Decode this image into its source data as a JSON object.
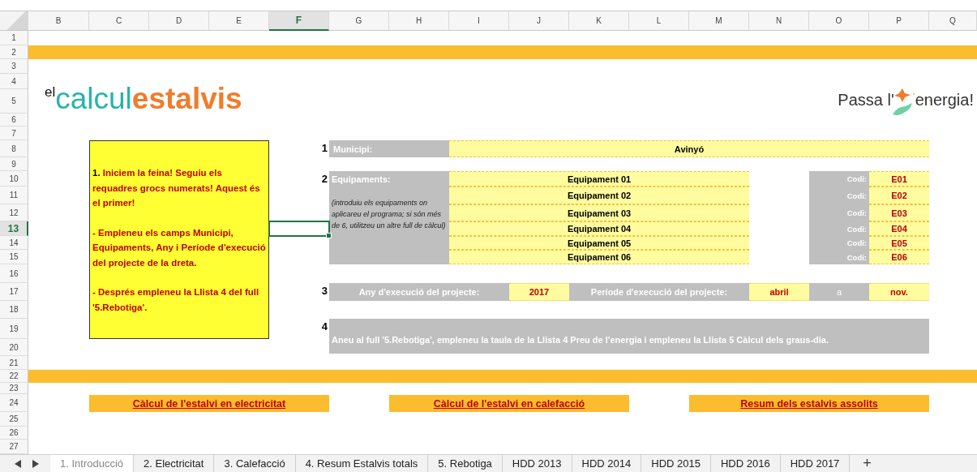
{
  "columns": [
    {
      "label": "B",
      "selected": false
    },
    {
      "label": "C",
      "selected": false
    },
    {
      "label": "D",
      "selected": false
    },
    {
      "label": "E",
      "selected": false
    },
    {
      "label": "F",
      "selected": true
    },
    {
      "label": "G",
      "selected": false
    },
    {
      "label": "H",
      "selected": false
    },
    {
      "label": "I",
      "selected": false
    },
    {
      "label": "J",
      "selected": false
    },
    {
      "label": "K",
      "selected": false
    },
    {
      "label": "L",
      "selected": false
    },
    {
      "label": "M",
      "selected": false
    },
    {
      "label": "N",
      "selected": false
    },
    {
      "label": "O",
      "selected": false
    },
    {
      "label": "P",
      "selected": false
    },
    {
      "label": "Q",
      "selected": false
    }
  ],
  "rows": [
    {
      "label": "1",
      "selected": false
    },
    {
      "label": "2",
      "selected": false
    },
    {
      "label": "3",
      "selected": false
    },
    {
      "label": "4",
      "selected": false
    },
    {
      "label": "5",
      "selected": false
    },
    {
      "label": "6",
      "selected": false
    },
    {
      "label": "7",
      "selected": false
    },
    {
      "label": "8",
      "selected": false
    },
    {
      "label": "9",
      "selected": false
    },
    {
      "label": "10",
      "selected": false
    },
    {
      "label": "11",
      "selected": false
    },
    {
      "label": "12",
      "selected": false
    },
    {
      "label": "13",
      "selected": true
    },
    {
      "label": "14",
      "selected": false
    },
    {
      "label": "15",
      "selected": false
    },
    {
      "label": "16",
      "selected": false
    },
    {
      "label": "17",
      "selected": false
    },
    {
      "label": "18",
      "selected": false
    },
    {
      "label": "19",
      "selected": false
    },
    {
      "label": "20",
      "selected": false
    },
    {
      "label": "21",
      "selected": false
    },
    {
      "label": "22",
      "selected": false
    },
    {
      "label": "23",
      "selected": false
    },
    {
      "label": "24",
      "selected": false
    },
    {
      "label": "25",
      "selected": false
    },
    {
      "label": "26",
      "selected": false
    },
    {
      "label": "27",
      "selected": false
    }
  ],
  "logo": {
    "prefix": "el",
    "part1": "calcul",
    "part2": "estalvis"
  },
  "slogan": {
    "before": "Passa l'",
    "after": "energia!"
  },
  "instructions": {
    "number": "1.",
    "paragraphs": [
      "Iniciem la feina! Seguiu els requadres grocs numerats! Aquest és el primer!",
      "- Empleneu els camps Municipi, Equipaments, Any i Període d'execució del projecte de la dreta.",
      "- Després empleneu la Llista 4 del full '5.Rebotiga'."
    ]
  },
  "municipality": {
    "number": "1",
    "label": "Municipi:",
    "value": "Avinyó"
  },
  "equipment": {
    "number": "2",
    "label": "Equipaments:",
    "note": "(introduiu els equipaments on aplicareu el programa; si són més de 6, utilitzeu un altre full de càlcul)",
    "items": [
      {
        "name": "Equipament 01",
        "code_label": "Codi:",
        "code": "E01"
      },
      {
        "name": "Equipament 02",
        "code_label": "Codi:",
        "code": "E02"
      },
      {
        "name": "Equipament 03",
        "code_label": "Codi:",
        "code": "E03"
      },
      {
        "name": "Equipament 04",
        "code_label": "Codi:",
        "code": "E04"
      },
      {
        "name": "Equipament 05",
        "code_label": "Codi:",
        "code": "E05"
      },
      {
        "name": "Equipament 06",
        "code_label": "Codi:",
        "code": "E06"
      }
    ]
  },
  "execution": {
    "number": "3",
    "year_label": "Any d'execució del projecte:",
    "year": "2017",
    "period_label": "Període d'execució del projecte:",
    "from": "abril",
    "to_label": "a",
    "to": "nov."
  },
  "step4": {
    "number": "4",
    "text": "Aneu al full '5.Rebotiga', empleneu la taula de la Llista 4 Preu de l'energia i empleneu la Llista 5 Càlcul dels graus-dia."
  },
  "links": [
    "Càlcul de l'estalvi en electricitat",
    "Càlcul de l'estalvi en calefacció",
    "Resum dels estalvis assolits"
  ],
  "sheet_tabs": [
    {
      "label": "1. Introducció",
      "selected": true
    },
    {
      "label": "2. Electricitat",
      "selected": false
    },
    {
      "label": "3. Calefacció",
      "selected": false
    },
    {
      "label": "4. Resum Estalvis totals",
      "selected": false
    },
    {
      "label": "5. Rebotiga",
      "selected": false
    },
    {
      "label": "HDD 2013",
      "selected": false
    },
    {
      "label": "HDD 2014",
      "selected": false
    },
    {
      "label": "HDD 2015",
      "selected": false
    },
    {
      "label": "HDD 2016",
      "selected": false
    },
    {
      "label": "HDD 2017",
      "selected": false
    }
  ],
  "add_tab": "+"
}
